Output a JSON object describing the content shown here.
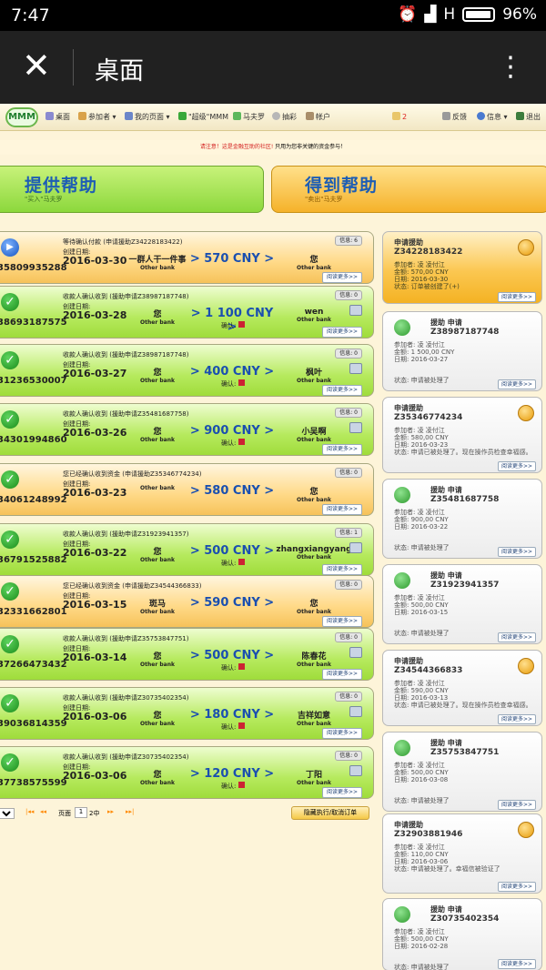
{
  "status_bar": {
    "time": "7:47",
    "network": "H",
    "battery": "96%"
  },
  "app_bar": {
    "close": "✕",
    "title": "桌面",
    "menu": "⋮"
  },
  "nav": {
    "logo": "MMM",
    "desk": "桌面",
    "participants": "参加者 ▾",
    "mypage": "我的页面 ▾",
    "super": "\"超级\"MMM",
    "mavrodi": "马夫罗",
    "lottery": "抽彩",
    "account": "帐户",
    "msg_count": "2",
    "feedback": "反馈",
    "info": "信息 ▾",
    "exit": "退出"
  },
  "notice": {
    "red": "请注意！这是金融互助的社区!",
    "rest": " 只用为您非关键的资金参与！"
  },
  "give_help": {
    "title": "提供帮助",
    "sub": "\"买入\"马夫罗"
  },
  "get_help": {
    "title": "得到帮助",
    "sub": "\"卖出\"马夫罗"
  },
  "rows": [
    {
      "color": "orange",
      "icon": "▶",
      "header": "等待确认付款 (申请援助Z34228183422)",
      "created": "创建日期:",
      "date": "2016-03-30",
      "id": "358099352​88",
      "from": "一群人干一件事",
      "from_bank": "Other bank",
      "amount": "570 CNY",
      "to": "您",
      "to_bank": "Other bank",
      "confirm": "",
      "info": "信息: 6",
      "more": "阅读更多>>"
    },
    {
      "color": "green",
      "icon": "✓",
      "header": "收款人确认收到 (援助申请Z38987187748)",
      "created": "创建日期:",
      "date": "2016-03-28",
      "id": "38693187575",
      "from": "您",
      "from_bank": "Other bank",
      "amount": "1 100 CNY",
      "to": "wen",
      "to_bank": "Other bank",
      "confirm": "确认:",
      "info": "信息: 0",
      "more": "阅读更多>>"
    },
    {
      "color": "green",
      "icon": "✓",
      "header": "收款人确认收到 (援助申请Z38987187748)",
      "created": "创建日期:",
      "date": "2016-03-27",
      "id": "31236530007",
      "from": "您",
      "from_bank": "Other bank",
      "amount": "400 CNY",
      "to": "枫叶",
      "to_bank": "Other bank",
      "confirm": "确认:",
      "info": "信息: 0",
      "more": "阅读更多>>"
    },
    {
      "color": "green",
      "icon": "✓",
      "header": "收款人确认收到 (援助申请Z35481687758)",
      "created": "创建日期:",
      "date": "2016-03-26",
      "id": "34301994860",
      "from": "您",
      "from_bank": "Other bank",
      "amount": "900 CNY",
      "to": "小吴啊",
      "to_bank": "Other bank",
      "confirm": "确认:",
      "info": "信息: 0",
      "more": "阅读更多>>"
    },
    {
      "color": "orange",
      "icon": "✓",
      "header": "您已经确认收到资金 (申请援助Z35346774234)",
      "created": "创建日期:",
      "date": "2016-03-23",
      "id": "34061248992",
      "from": "",
      "from_bank": "Other bank",
      "amount": "580 CNY",
      "to": "您",
      "to_bank": "Other bank",
      "confirm": "",
      "info": "信息: 0",
      "more": "阅读更多>>"
    },
    {
      "color": "green",
      "icon": "✓",
      "header": "收款人确认收到 (援助申请Z31923941357)",
      "created": "创建日期:",
      "date": "2016-03-22",
      "id": "36791525882",
      "from": "您",
      "from_bank": "Other bank",
      "amount": "500 CNY",
      "to": "zhangxiangyang",
      "to_bank": "Other bank",
      "confirm": "确认:",
      "info": "信息: 1",
      "more": "阅读更多>>"
    },
    {
      "color": "orange",
      "icon": "✓",
      "header": "您已经确认收到资金 (申请援助Z34544366833)",
      "created": "创建日期:",
      "date": "2016-03-15",
      "id": "32331662801",
      "from": "斑马",
      "from_bank": "Other bank",
      "amount": "590 CNY",
      "to": "您",
      "to_bank": "Other bank",
      "confirm": "",
      "info": "信息: 0",
      "more": "阅读更多>>"
    },
    {
      "color": "green",
      "icon": "✓",
      "header": "收款人确认收到 (援助申请Z35753847751)",
      "created": "创建日期:",
      "date": "2016-03-14",
      "id": "37266473432",
      "from": "您",
      "from_bank": "Other bank",
      "amount": "500 CNY",
      "to": "陈春花",
      "to_bank": "Other bank",
      "confirm": "确认:",
      "info": "信息: 0",
      "more": "阅读更多>>"
    },
    {
      "color": "green",
      "icon": "✓",
      "header": "收款人确认收到 (援助申请Z30735402354)",
      "created": "创建日期:",
      "date": "2016-03-06",
      "id": "39036814359",
      "from": "您",
      "from_bank": "Other bank",
      "amount": "180 CNY",
      "to": "吉祥如意",
      "to_bank": "Other bank",
      "confirm": "确认:",
      "info": "信息: 0",
      "more": "阅读更多>>"
    },
    {
      "color": "green",
      "icon": "✓",
      "header": "收款人确认收到 (援助申请Z30735402354)",
      "created": "创建日期:",
      "date": "2016-03-06",
      "id": "37738575599",
      "from": "您",
      "from_bank": "Other bank",
      "amount": "120 CNY",
      "to": "丁阳",
      "to_bank": "Other bank",
      "confirm": "确认:",
      "info": "信息: 0",
      "more": "阅读更多>>"
    }
  ],
  "pager": {
    "page_label": "页面",
    "page": "1",
    "of": "2中",
    "hide": "隐藏执行/取消订单",
    "first": "|◂◂",
    "prev": "◂◂",
    "next": "▸▸",
    "last": "▸▸|"
  },
  "cards": [
    {
      "hl": true,
      "title": "申请援助",
      "cid": "Z34228183422",
      "lines": [
        "参加者: 凌 凌付江",
        "金额: 570,00 CNY",
        "日期: 2016-03-30",
        "状态: 订单被创建了(+)"
      ],
      "status": "",
      "more": "阅读更多>>"
    },
    {
      "hl": false,
      "title": "援助 申请",
      "cid": "Z38987187748",
      "lines": [
        "参加者: 凌 凌付江",
        "金额: 1 500,00 CNY",
        "日期: 2016-03-27"
      ],
      "status": "状态: 申请被处理了",
      "more": "阅读更多>>"
    },
    {
      "hl": false,
      "title": "申请援助",
      "cid": "Z35346774234",
      "lines": [
        "参加者: 凌 凌付江",
        "金额: 580,00 CNY",
        "日期: 2016-03-23",
        "状态: 申请已被处理了。现在操作员检查幸福感。"
      ],
      "status": "",
      "more": "阅读更多>>"
    },
    {
      "hl": false,
      "title": "援助 申请",
      "cid": "Z35481687758",
      "lines": [
        "参加者: 凌 凌付江",
        "金额: 900,00 CNY",
        "日期: 2016-03-22"
      ],
      "status": "状态: 申请被处理了",
      "more": "阅读更多>>"
    },
    {
      "hl": false,
      "title": "援助 申请",
      "cid": "Z31923941357",
      "lines": [
        "参加者: 凌 凌付江",
        "金额: 500,00 CNY",
        "日期: 2016-03-15"
      ],
      "status": "状态: 申请被处理了",
      "more": "阅读更多>>"
    },
    {
      "hl": false,
      "title": "申请援助",
      "cid": "Z34544366833",
      "lines": [
        "参加者: 凌 凌付江",
        "金额: 590,00 CNY",
        "日期: 2016-03-13",
        "状态: 申请已被处理了。现在操作员检查幸福感。"
      ],
      "status": "",
      "more": "阅读更多>>"
    },
    {
      "hl": false,
      "title": "援助 申请",
      "cid": "Z35753847751",
      "lines": [
        "参加者: 凌 凌付江",
        "金额: 500,00 CNY",
        "日期: 2016-03-08"
      ],
      "status": "状态: 申请被处理了",
      "more": "阅读更多>>"
    },
    {
      "hl": false,
      "title": "申请援助",
      "cid": "Z32903881946",
      "lines": [
        "参加者: 凌 凌付江",
        "金额: 110,00 CNY",
        "日期: 2016-03-06",
        "状态: 申请被处理了。幸福信被验证了"
      ],
      "status": "",
      "more": "阅读更多>>"
    },
    {
      "hl": false,
      "title": "援助 申请",
      "cid": "Z30735402354",
      "lines": [
        "参加者: 凌 凌付江",
        "金额: 500,00 CNY",
        "日期: 2016-02-28"
      ],
      "status": "状态: 申请被处理了",
      "more": "阅读更多>>"
    }
  ]
}
